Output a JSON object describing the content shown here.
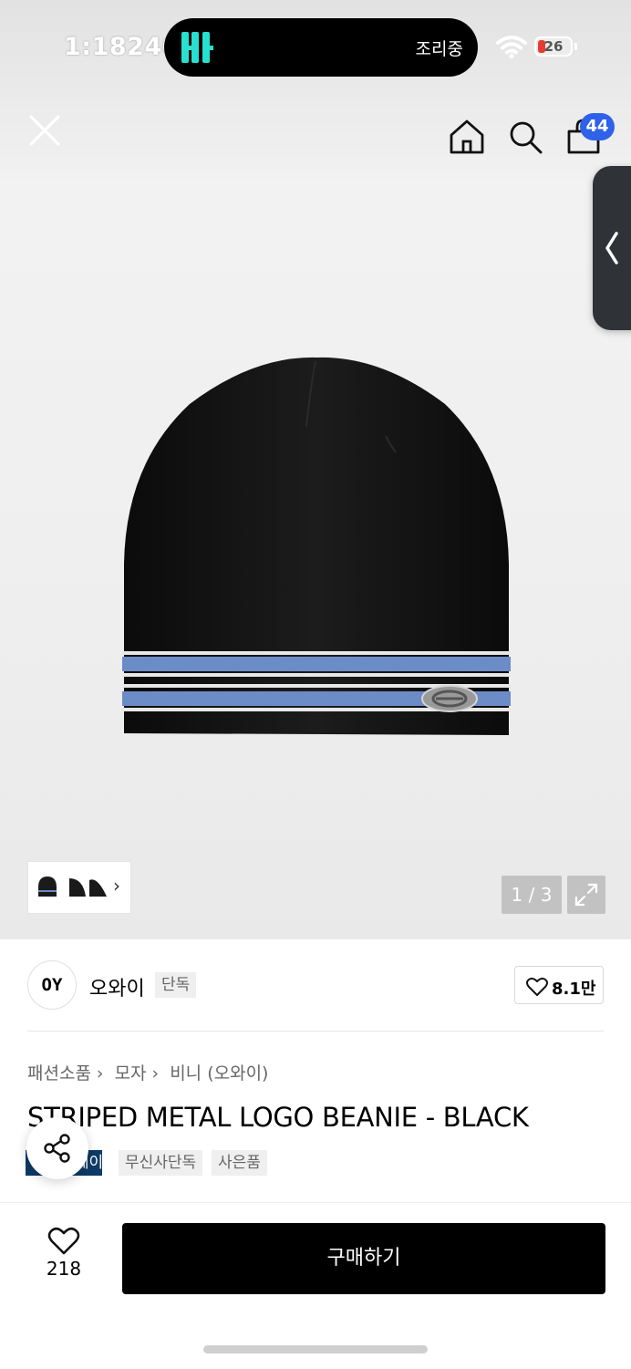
{
  "status_bar": {
    "time": "1:18240",
    "island_text": "조리중",
    "battery": "26",
    "colors": {
      "island_app": "#27e0cf",
      "battery_low": "#e43d30"
    }
  },
  "nav": {
    "cart_count": "44",
    "icons": [
      "close-icon",
      "home-icon",
      "search-icon",
      "bag-icon",
      "chevron-left-icon"
    ]
  },
  "gallery": {
    "counter": "1 / 3",
    "thumbnail_chevron": "›"
  },
  "brand": {
    "logo_text": "OY",
    "name": "오와이",
    "badge": "단독",
    "likes": "8.1만"
  },
  "breadcrumb": [
    "패션소품",
    "모자",
    "비니 (오와이)"
  ],
  "breadcrumb_separator": "›",
  "product": {
    "title": "STRIPED METAL LOGO BEANIE - BLACK",
    "tags": [
      "무신사페이",
      "무신사단독",
      "사은품"
    ]
  },
  "bottom_bar": {
    "wish_count": "218",
    "buy_label": "구매하기"
  },
  "colors": {
    "accent_badge": "#2f62e8",
    "pay_tag": "#0e3a66",
    "buy_button": "#000000"
  }
}
